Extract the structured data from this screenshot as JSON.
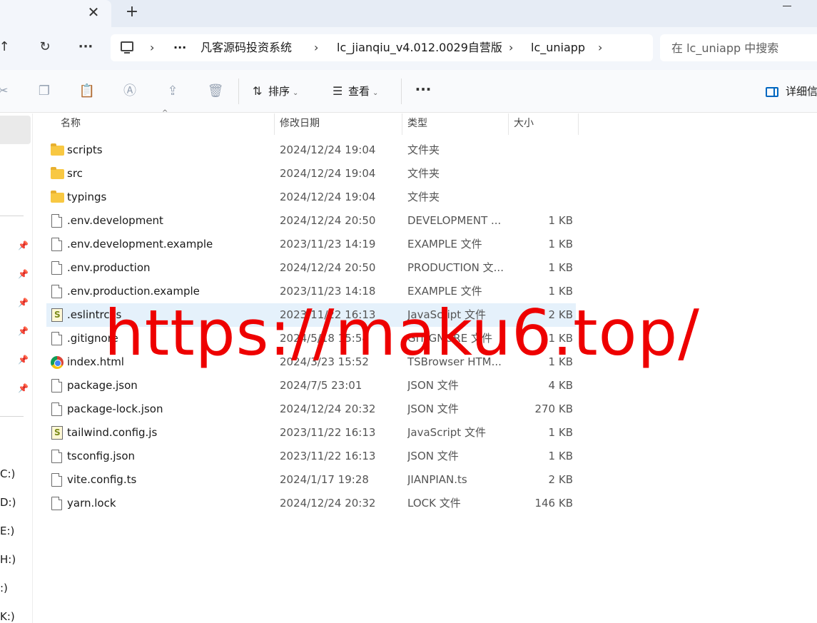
{
  "tabbar": {
    "close_glyph": "✕",
    "add_glyph": "+"
  },
  "breadcrumb": {
    "overflow": "···",
    "items": [
      "凡客源码投资系统",
      "lc_jianqiu_v4.012.0029自营版",
      "lc_uniapp"
    ]
  },
  "search": {
    "placeholder": "在 lc_uniapp 中搜索"
  },
  "toolbar": {
    "sort_label": "排序",
    "view_label": "查看",
    "more_label": "···",
    "details_label": "详细信"
  },
  "columns": {
    "name": "名称",
    "date": "修改日期",
    "type": "类型",
    "size": "大小"
  },
  "files": [
    {
      "name": "scripts",
      "date": "2024/12/24 19:04",
      "type": "文件夹",
      "size": "",
      "icon": "folder-icon"
    },
    {
      "name": "src",
      "date": "2024/12/24 19:04",
      "type": "文件夹",
      "size": "",
      "icon": "folder-icon"
    },
    {
      "name": "typings",
      "date": "2024/12/24 19:04",
      "type": "文件夹",
      "size": "",
      "icon": "folder-icon"
    },
    {
      "name": ".env.development",
      "date": "2024/12/24 20:50",
      "type": "DEVELOPMENT ...",
      "size": "1 KB",
      "icon": "file-icon"
    },
    {
      "name": ".env.development.example",
      "date": "2023/11/23 14:19",
      "type": "EXAMPLE 文件",
      "size": "1 KB",
      "icon": "file-icon"
    },
    {
      "name": ".env.production",
      "date": "2024/12/24 20:50",
      "type": "PRODUCTION 文...",
      "size": "1 KB",
      "icon": "file-icon"
    },
    {
      "name": ".env.production.example",
      "date": "2023/11/23 14:18",
      "type": "EXAMPLE 文件",
      "size": "1 KB",
      "icon": "file-icon"
    },
    {
      "name": ".eslintrc.js",
      "date": "2023/11/22 16:13",
      "type": "JavaScript 文件",
      "size": "2 KB",
      "icon": "js-file-icon"
    },
    {
      "name": ".gitignore",
      "date": "2024/5/18 15:54",
      "type": "GITIGNORE 文件",
      "size": "1 KB",
      "icon": "file-icon"
    },
    {
      "name": "index.html",
      "date": "2024/3/23 15:52",
      "type": "TSBrowser HTM...",
      "size": "1 KB",
      "icon": "web-file-icon"
    },
    {
      "name": "package.json",
      "date": "2024/7/5 23:01",
      "type": "JSON 文件",
      "size": "4 KB",
      "icon": "file-icon"
    },
    {
      "name": "package-lock.json",
      "date": "2024/12/24 20:32",
      "type": "JSON 文件",
      "size": "270 KB",
      "icon": "file-icon"
    },
    {
      "name": "tailwind.config.js",
      "date": "2023/11/22 16:13",
      "type": "JavaScript 文件",
      "size": "1 KB",
      "icon": "js-file-icon"
    },
    {
      "name": "tsconfig.json",
      "date": "2023/11/22 16:13",
      "type": "JSON 文件",
      "size": "1 KB",
      "icon": "file-icon"
    },
    {
      "name": "vite.config.ts",
      "date": "2024/1/17 19:28",
      "type": "JIANPIAN.ts",
      "size": "2 KB",
      "icon": "file-icon"
    },
    {
      "name": "yarn.lock",
      "date": "2024/12/24 20:32",
      "type": "LOCK 文件",
      "size": "146 KB",
      "icon": "file-icon"
    }
  ],
  "selected_index": 7,
  "sidebar": {
    "drives": [
      "C:)",
      "D:)",
      "E:)",
      "H:)",
      ":)",
      "K:)"
    ]
  },
  "watermark": "https://maku6.top/",
  "colors": {
    "accent": "#0067c0",
    "selection": "#e5f1fb",
    "watermark": "#ee0000",
    "folder": "#f8c842"
  }
}
